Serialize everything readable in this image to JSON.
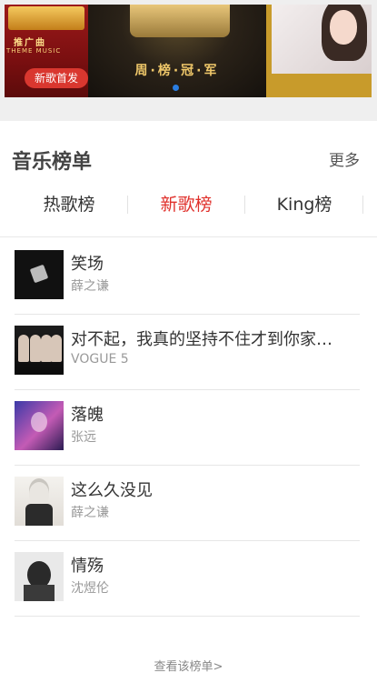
{
  "banner": {
    "left_line1": "推广曲",
    "left_line2": "THEME MUSIC",
    "left_button": "新歌首发",
    "center_caption": "周·榜·冠·军",
    "active_dot_color": "#2a7de1"
  },
  "section": {
    "title": "音乐榜单",
    "more": "更多"
  },
  "tabs": [
    {
      "label": "热歌榜",
      "active": false
    },
    {
      "label": "新歌榜",
      "active": true
    },
    {
      "label": "King榜",
      "active": false
    }
  ],
  "songs": [
    {
      "title": "笑场",
      "artist": "薛之谦"
    },
    {
      "title": "对不起，我真的坚持不住才到你家…",
      "artist": "VOGUE 5"
    },
    {
      "title": "落魄",
      "artist": "张远"
    },
    {
      "title": "这么久没见",
      "artist": "薛之谦"
    },
    {
      "title": "情殇",
      "artist": "沈煜伦"
    }
  ],
  "footer": {
    "link": "查看该榜单>"
  },
  "colors": {
    "accent": "#e0312c",
    "banner_button": "#d9372f"
  }
}
